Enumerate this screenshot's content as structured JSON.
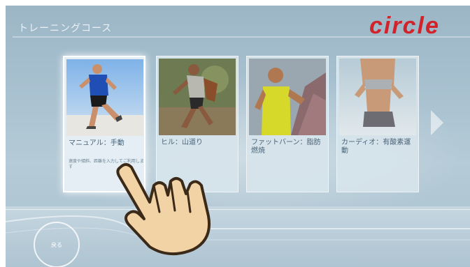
{
  "header": {
    "title": "トレーニングコース",
    "brand": "circle"
  },
  "courses": [
    {
      "name": "マニュアル：手動",
      "desc": "速度や傾斜、距離を入力してご利用します"
    },
    {
      "name": "ヒル：山道り",
      "desc": ""
    },
    {
      "name": "ファットバーン：脂肪燃焼",
      "desc": ""
    },
    {
      "name": "カーディオ：有酸素運動",
      "desc": ""
    }
  ],
  "nav": {
    "home_label": "戻る"
  },
  "colors": {
    "brand": "#d3232a",
    "background": "#a7c0cf"
  }
}
